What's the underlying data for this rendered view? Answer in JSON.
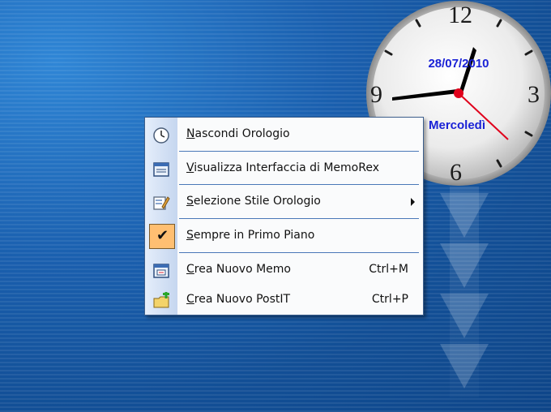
{
  "clock": {
    "numbers": {
      "n12": "12",
      "n3": "3",
      "n6": "6",
      "n9": "9"
    },
    "date": "28/07/2010",
    "day": "Mercoledì",
    "text_color": "#1a22d6",
    "second_hand_color": "#e0001b"
  },
  "menu": {
    "items": [
      {
        "label": "Nascondi Orologio",
        "shortcut": "",
        "icon": "clock-icon"
      },
      {
        "label": "Visualizza Interfaccia di MemoRex",
        "shortcut": "",
        "icon": "window-icon"
      },
      {
        "label": "Selezione Stile Orologio",
        "shortcut": "",
        "icon": "style-edit-icon",
        "submenu": true
      },
      {
        "label": "Sempre in Primo Piano",
        "shortcut": "",
        "icon": "checkmark-icon",
        "checked": true
      },
      {
        "label": "Crea Nuovo Memo",
        "shortcut": "Ctrl+M",
        "icon": "memo-icon"
      },
      {
        "label": "Crea Nuovo PostIT",
        "shortcut": "Ctrl+P",
        "icon": "postit-folder-icon"
      }
    ],
    "check_highlight_color": "#ffbf72",
    "border_color": "#3d5f8c"
  }
}
